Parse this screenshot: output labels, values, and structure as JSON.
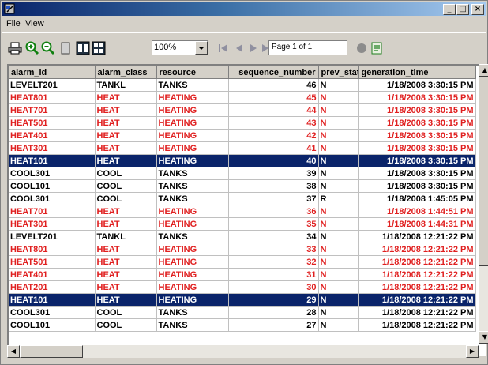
{
  "window": {
    "title": "",
    "min": "_",
    "max": "□",
    "close": "×"
  },
  "menu": {
    "items": [
      "File",
      "View"
    ]
  },
  "toolbar": {
    "icons": [
      "print-icon",
      "zoom-in-icon",
      "zoom-out-icon",
      "single-page-icon",
      "two-page-icon",
      "multi-page-icon",
      "first-page-icon",
      "previous-page-icon",
      "next-page-icon",
      "last-page-icon",
      "stop-icon",
      "export-icon"
    ],
    "zoom": "100%",
    "page": "Page 1 of 1"
  },
  "grid": {
    "columns": [
      "alarm_id",
      "alarm_class",
      "resource",
      "sequence_number",
      "prev_state",
      "generation_time"
    ],
    "rows": [
      {
        "alarm_id": "LEVELT201",
        "alarm_class": "TANKL",
        "resource": "TANKS",
        "seq": "46",
        "prev": "N",
        "time": "1/18/2008 3:30:15 PM",
        "color": "black",
        "selected": false
      },
      {
        "alarm_id": "HEAT801",
        "alarm_class": "HEAT",
        "resource": "HEATING",
        "seq": "45",
        "prev": "N",
        "time": "1/18/2008 3:30:15 PM",
        "color": "red",
        "selected": false
      },
      {
        "alarm_id": "HEAT701",
        "alarm_class": "HEAT",
        "resource": "HEATING",
        "seq": "44",
        "prev": "N",
        "time": "1/18/2008 3:30:15 PM",
        "color": "red",
        "selected": false
      },
      {
        "alarm_id": "HEAT501",
        "alarm_class": "HEAT",
        "resource": "HEATING",
        "seq": "43",
        "prev": "N",
        "time": "1/18/2008 3:30:15 PM",
        "color": "red",
        "selected": false
      },
      {
        "alarm_id": "HEAT401",
        "alarm_class": "HEAT",
        "resource": "HEATING",
        "seq": "42",
        "prev": "N",
        "time": "1/18/2008 3:30:15 PM",
        "color": "red",
        "selected": false
      },
      {
        "alarm_id": "HEAT301",
        "alarm_class": "HEAT",
        "resource": "HEATING",
        "seq": "41",
        "prev": "N",
        "time": "1/18/2008 3:30:15 PM",
        "color": "red",
        "selected": false
      },
      {
        "alarm_id": "HEAT101",
        "alarm_class": "HEAT",
        "resource": "HEATING",
        "seq": "40",
        "prev": "N",
        "time": "1/18/2008 3:30:15 PM",
        "color": "red",
        "selected": true
      },
      {
        "alarm_id": "COOL301",
        "alarm_class": "COOL",
        "resource": "TANKS",
        "seq": "39",
        "prev": "N",
        "time": "1/18/2008 3:30:15 PM",
        "color": "black",
        "selected": false
      },
      {
        "alarm_id": "COOL101",
        "alarm_class": "COOL",
        "resource": "TANKS",
        "seq": "38",
        "prev": "N",
        "time": "1/18/2008 3:30:15 PM",
        "color": "black",
        "selected": false
      },
      {
        "alarm_id": "COOL301",
        "alarm_class": "COOL",
        "resource": "TANKS",
        "seq": "37",
        "prev": "R",
        "time": "1/18/2008 1:45:05 PM",
        "color": "black",
        "selected": false
      },
      {
        "alarm_id": "HEAT701",
        "alarm_class": "HEAT",
        "resource": "HEATING",
        "seq": "36",
        "prev": "N",
        "time": "1/18/2008 1:44:51 PM",
        "color": "red",
        "selected": false
      },
      {
        "alarm_id": "HEAT301",
        "alarm_class": "HEAT",
        "resource": "HEATING",
        "seq": "35",
        "prev": "N",
        "time": "1/18/2008 1:44:31 PM",
        "color": "red",
        "selected": false
      },
      {
        "alarm_id": "LEVELT201",
        "alarm_class": "TANKL",
        "resource": "TANKS",
        "seq": "34",
        "prev": "N",
        "time": "1/18/2008 12:21:22 PM",
        "color": "black",
        "selected": false
      },
      {
        "alarm_id": "HEAT801",
        "alarm_class": "HEAT",
        "resource": "HEATING",
        "seq": "33",
        "prev": "N",
        "time": "1/18/2008 12:21:22 PM",
        "color": "red",
        "selected": false
      },
      {
        "alarm_id": "HEAT501",
        "alarm_class": "HEAT",
        "resource": "HEATING",
        "seq": "32",
        "prev": "N",
        "time": "1/18/2008 12:21:22 PM",
        "color": "red",
        "selected": false
      },
      {
        "alarm_id": "HEAT401",
        "alarm_class": "HEAT",
        "resource": "HEATING",
        "seq": "31",
        "prev": "N",
        "time": "1/18/2008 12:21:22 PM",
        "color": "red",
        "selected": false
      },
      {
        "alarm_id": "HEAT201",
        "alarm_class": "HEAT",
        "resource": "HEATING",
        "seq": "30",
        "prev": "N",
        "time": "1/18/2008 12:21:22 PM",
        "color": "red",
        "selected": false
      },
      {
        "alarm_id": "HEAT101",
        "alarm_class": "HEAT",
        "resource": "HEATING",
        "seq": "29",
        "prev": "N",
        "time": "1/18/2008 12:21:22 PM",
        "color": "red",
        "selected": true
      },
      {
        "alarm_id": "COOL301",
        "alarm_class": "COOL",
        "resource": "TANKS",
        "seq": "28",
        "prev": "N",
        "time": "1/18/2008 12:21:22 PM",
        "color": "black",
        "selected": false
      },
      {
        "alarm_id": "COOL101",
        "alarm_class": "COOL",
        "resource": "TANKS",
        "seq": "27",
        "prev": "N",
        "time": "1/18/2008 12:21:22 PM",
        "color": "black",
        "selected": false
      }
    ]
  },
  "colors": {
    "red": "#e02020",
    "selection": "#0a246a",
    "title_start": "#0a246a",
    "title_end": "#a6caf0"
  }
}
